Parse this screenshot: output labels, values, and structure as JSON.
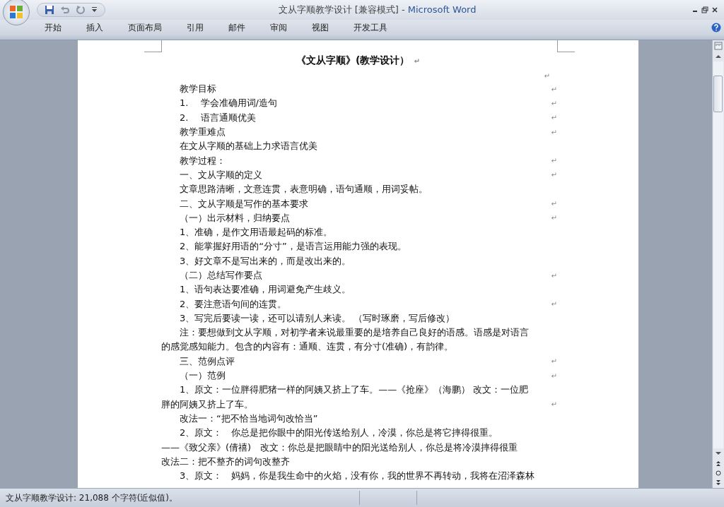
{
  "window": {
    "title": "文从字顺教学设计 [兼容模式]",
    "separator": "-",
    "app_name": "Microsoft Word"
  },
  "ribbon_tabs": [
    {
      "label": "开始",
      "selected": false
    },
    {
      "label": "插入",
      "selected": false
    },
    {
      "label": "页面布局",
      "selected": false
    },
    {
      "label": "引用",
      "selected": false
    },
    {
      "label": "邮件",
      "selected": false
    },
    {
      "label": "审阅",
      "selected": false
    },
    {
      "label": "视图",
      "selected": false
    },
    {
      "label": "开发工具",
      "selected": false
    }
  ],
  "document": {
    "lines": [
      {
        "kind": "title",
        "text": "《文从字顺》(教学设计）",
        "mark": "↵"
      },
      {
        "kind": "blank",
        "mark": "↵"
      },
      {
        "kind": "para",
        "text": "教学目标",
        "mark": "↵"
      },
      {
        "kind": "para",
        "text": "1.　 学会准确用词/造句",
        "mark": "↵"
      },
      {
        "kind": "para",
        "text": "2.　 语言通顺优美",
        "mark": "↵"
      },
      {
        "kind": "para",
        "text": "教学重难点",
        "mark": "↵"
      },
      {
        "kind": "para",
        "text": "在文从字顺的基础上力求语言优美"
      },
      {
        "kind": "para",
        "text": "教学过程：",
        "mark": "↵"
      },
      {
        "kind": "para",
        "text": "一、文从字顺的定义",
        "mark": "↵"
      },
      {
        "kind": "para",
        "text": "文章思路清晰，文意连贯，表意明确，语句通顺，用词妥帖。"
      },
      {
        "kind": "para",
        "text": "二、文从字顺是写作的基本要求",
        "mark": "↵"
      },
      {
        "kind": "para",
        "text": "（一）出示材料，归纳要点",
        "mark": "↵"
      },
      {
        "kind": "para",
        "text": "1、准确，是作文用语最起码的标准。"
      },
      {
        "kind": "para",
        "text": "2、能掌握好用语的“分寸”，是语言运用能力强的表现。"
      },
      {
        "kind": "para",
        "text": "3、好文章不是写出来的，而是改出来的。"
      },
      {
        "kind": "para",
        "text": "（二）总结写作要点",
        "mark": "↵"
      },
      {
        "kind": "para",
        "text": "1、语句表达要准确，用词避免产生歧义。"
      },
      {
        "kind": "para",
        "text": "2、要注意语句间的连贯。",
        "mark": "↵"
      },
      {
        "kind": "para",
        "text": "3、写完后要读一读，还可以请别人来读。 （写时琢磨，写后修改）"
      },
      {
        "kind": "para",
        "text": "注：要想做到文从字顺，对初学者来说最重要的是培养自己良好的语感。语感是对语言"
      },
      {
        "kind": "wrap",
        "text": "的感觉感知能力。包含的内容有：通顺、连贯，有分寸(准确)，有韵律。"
      },
      {
        "kind": "para",
        "text": "三、范例点评",
        "mark": "↵"
      },
      {
        "kind": "para",
        "text": "（一）范例",
        "mark": "↵"
      },
      {
        "kind": "para",
        "text": "1、原文：一位胖得肥猪一样的阿姨又挤上了车。——《抢座》（海鹏） 改文：一位肥"
      },
      {
        "kind": "wrap",
        "text": "胖的阿姨又挤上了车。",
        "mark": "↵"
      },
      {
        "kind": "para",
        "text": "改法一：“把不恰当地词句改恰当”"
      },
      {
        "kind": "para",
        "text": "2、原文：　你总是把你眼中的阳光传送给别人，冷漠，你总是将它摔得很重。"
      },
      {
        "kind": "wrap",
        "text": "——《致父亲》(倩禧)　改文：你总是把眼睛中的阳光送给别人，你总是将冷漠摔得很重"
      },
      {
        "kind": "wrap",
        "text": "改法二：把不整齐的词句改整齐"
      },
      {
        "kind": "para",
        "text": "3、原文：　妈妈，你是我生命中的火焰，没有你，我的世界不再转动，我将在沼泽森林"
      }
    ]
  },
  "status_bar": {
    "text": "文从字顺教学设计: 21,088 个字符(近似值)。"
  }
}
